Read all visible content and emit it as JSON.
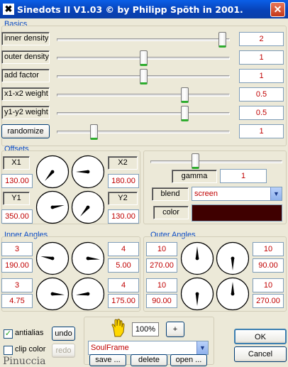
{
  "window": {
    "title": "Sinedots II V1.03 © by Philipp Spöth in 2001.",
    "icon_glyph": "✖",
    "close_glyph": "✕"
  },
  "basics": {
    "title": "Basics",
    "sliders": [
      {
        "label": "inner density",
        "value": "2",
        "level": 0.98
      },
      {
        "label": "outer density",
        "value": "1",
        "level": 0.5
      },
      {
        "label": "add factor",
        "value": "1",
        "level": 0.5
      },
      {
        "label": "x1-x2 weight",
        "value": "0.5",
        "level": 0.75
      },
      {
        "label": "y1-y2 weight",
        "value": "0.5",
        "level": 0.75
      },
      {
        "label": "randomize",
        "value": "1",
        "level": 0.2
      }
    ]
  },
  "offsets": {
    "title": "Offsets",
    "x1_label": "X1",
    "x1_value": "130.00",
    "y1_label": "Y1",
    "y1_value": "350.00",
    "x2_label": "X2",
    "x2_value": "180.00",
    "y2_label": "Y2",
    "y2_value": "130.00",
    "dials": [
      130,
      180,
      350,
      130
    ]
  },
  "gamma": {
    "label": "gamma",
    "value": "1",
    "level": 0.33
  },
  "blend": {
    "label": "blend",
    "value": "screen"
  },
  "color": {
    "label": "color",
    "swatch": "#3f0000"
  },
  "inner_angles": {
    "title": "Inner Angles",
    "values": [
      [
        "3",
        "190.00"
      ],
      [
        "4",
        "5.00"
      ],
      [
        "3",
        "4.75"
      ],
      [
        "4",
        "175.00"
      ]
    ],
    "dials": [
      190,
      5,
      4.75,
      175
    ]
  },
  "outer_angles": {
    "title": "Outer Angles",
    "values": [
      [
        "10",
        "270.00"
      ],
      [
        "10",
        "90.00"
      ],
      [
        "10",
        "90.00"
      ],
      [
        "10",
        "270.00"
      ]
    ],
    "dials": [
      270,
      90,
      90,
      270
    ]
  },
  "options": {
    "antialias": "antialias",
    "antialias_checked": "✓",
    "clip_color": "clip color",
    "undo": "undo",
    "redo": "redo"
  },
  "preset": {
    "zoom": "100%",
    "plus": "+",
    "name": "SoulFrame",
    "save": "save ...",
    "delete": "delete",
    "open": "open ..."
  },
  "actions": {
    "ok": "OK",
    "cancel": "Cancel"
  },
  "signature": "Pinuccia"
}
